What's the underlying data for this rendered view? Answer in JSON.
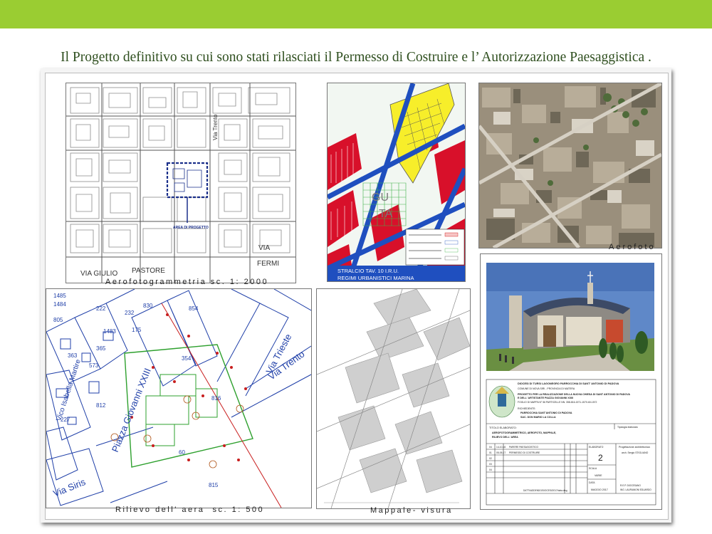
{
  "slide": {
    "title": "Il Progetto definitivo su cui sono stati rilasciati il Permesso di Costruire e l’ Autorizzazione Paesaggistica ."
  },
  "board": {
    "panels": {
      "aerofotogrammetria": {
        "caption": "Aerofotogrammetria sc. 1: 2000",
        "streets": [
          "Via Trento",
          "VIA",
          "FERMI",
          "VIA GIULIO",
          "PASTORE"
        ]
      },
      "stralcio": {
        "banner_line1": "STRALCIO TAV. 10 I.R.U.",
        "banner_line2": "REGIMI URBANISTICI MARINA",
        "zone_labels": [
          "GU",
          "TA"
        ]
      },
      "aerofoto": {
        "caption": "Aerofoto"
      },
      "rilievo": {
        "caption": "Rilievo dell' aera  sc. 1: 500",
        "streets": [
          "Via Trieste",
          "Via Trento",
          "Piazza Giovanni XXIII",
          "Vico Isabella Martire",
          "Via Siris"
        ],
        "parcels": [
          "1485",
          "1484",
          "222",
          "232",
          "830",
          "805",
          "175",
          "1483",
          "854",
          "354",
          "816",
          "812",
          "60",
          "815",
          "573",
          "363",
          "365",
          "227"
        ]
      },
      "mappale": {
        "caption": "Mappale- visura"
      },
      "title_block": {
        "header_line1": "DIOCESI DI TURSI LAGONEGRO   PARROCCHIA DI SANT' ANTONIO DI PADOVA",
        "header_line2": "COMUNE DI NOVA SIRI - PROVINCIA DI MATERA",
        "project_line1": "PROGETTO PER LA REALIZZAZIONE DELLA NUOVA CHIESA DI SANT ANTONIO DI PADOVA",
        "project_line2": "E DELL' ARTISTANTE PIAZZA GIOVANNI XXIII",
        "project_line3": "FOGLIO DI MAPPA N° 56 PARTICELLE NN. 358-816-1571-1570-60-1572",
        "richiedente_label": "RICHIEDENTE:",
        "richiedente_1": "PARROCCHIA SANT'ANTONIO DI PADOVA",
        "richiedente_2": "SAC. DON MARIO LA COLLA",
        "titolo_label": "TITOLO ELABORATO:",
        "titolo_1": "AEROFOTOGRAMMETRICO, AEROFOTO, MAPPALE,",
        "titolo_2": "RILIEVO DELL' AREA",
        "tipo_label": "Tipologia elaborato",
        "elab_label": "ELABORATO",
        "elab_number": "2",
        "scala_label": "SCALA",
        "scala_value": "VARIE",
        "data_label": "DATA",
        "data_value": "MAGGIO 2017",
        "progettazione_label": "Progettazione architettonica:",
        "progettazione_name": "arch. Sergio STIGLIANO",
        "rev_rows": [
          {
            "n": "04",
            "date": "14-10-16",
            "desc": "PARERE PAESAGGISTICO"
          },
          {
            "n": "01",
            "date": "05-05-17",
            "desc": "PERMESSO DI COSTRUIRE"
          },
          {
            "n": "02",
            "date": "",
            "desc": ""
          },
          {
            "n": "03",
            "date": "",
            "desc": ""
          },
          {
            "n": "04",
            "date": "",
            "desc": ""
          }
        ],
        "footer_left": "DATTI/ADDENDO/DIOCESI/2017/data.dwg",
        "footer_right_1": "R.E.P. DIOCESANO",
        "footer_right_2": "ING. LAURIANONI EDUARDO"
      }
    }
  }
}
